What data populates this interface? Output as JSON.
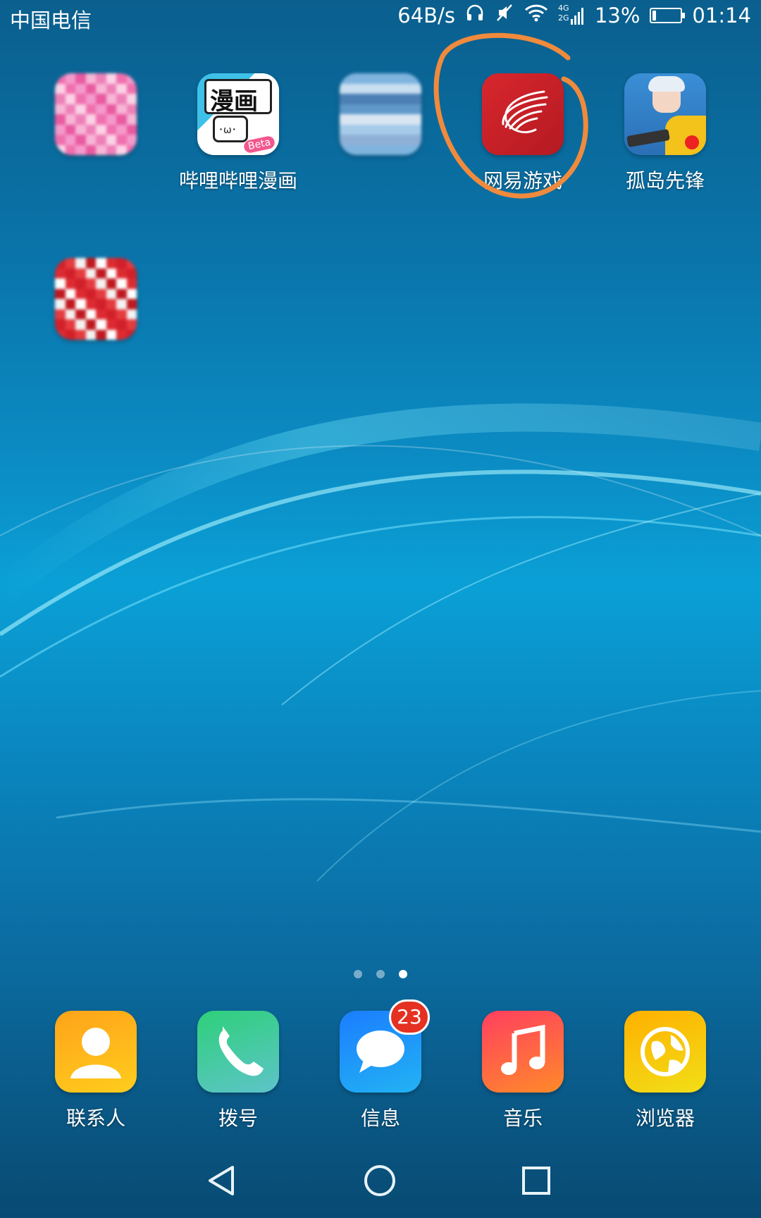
{
  "status_bar": {
    "carrier": "中国电信",
    "net_speed": "64B/s",
    "network_label_top": "4G",
    "network_label_bottom": "2G",
    "battery_percent": "13%",
    "battery_level": 0.13,
    "time": "01:14"
  },
  "home_apps": [
    {
      "label": "",
      "icon": "blurred-pink-app-icon"
    },
    {
      "label": "哔哩哔哩漫画",
      "icon": "bilibili-comics-icon",
      "icon_text": "漫画",
      "icon_badge": "Beta"
    },
    {
      "label": "",
      "icon": "blurred-blue-app-icon"
    },
    {
      "label": "网易游戏",
      "icon": "netease-games-icon"
    },
    {
      "label": "孤岛先锋",
      "icon": "island-vanguard-icon"
    },
    {
      "label": "",
      "icon": "blurred-red-app-icon"
    }
  ],
  "page_indicator": {
    "total": 3,
    "active": 3
  },
  "dock": [
    {
      "label": "联系人",
      "icon": "contacts-icon"
    },
    {
      "label": "拨号",
      "icon": "phone-icon"
    },
    {
      "label": "信息",
      "icon": "messages-icon",
      "badge": "23"
    },
    {
      "label": "音乐",
      "icon": "music-icon"
    },
    {
      "label": "浏览器",
      "icon": "browser-icon"
    }
  ],
  "nav_bar": {
    "back": "back-icon",
    "home": "home-icon",
    "recents": "recents-icon"
  },
  "annotation": {
    "color": "#f08a3c"
  }
}
